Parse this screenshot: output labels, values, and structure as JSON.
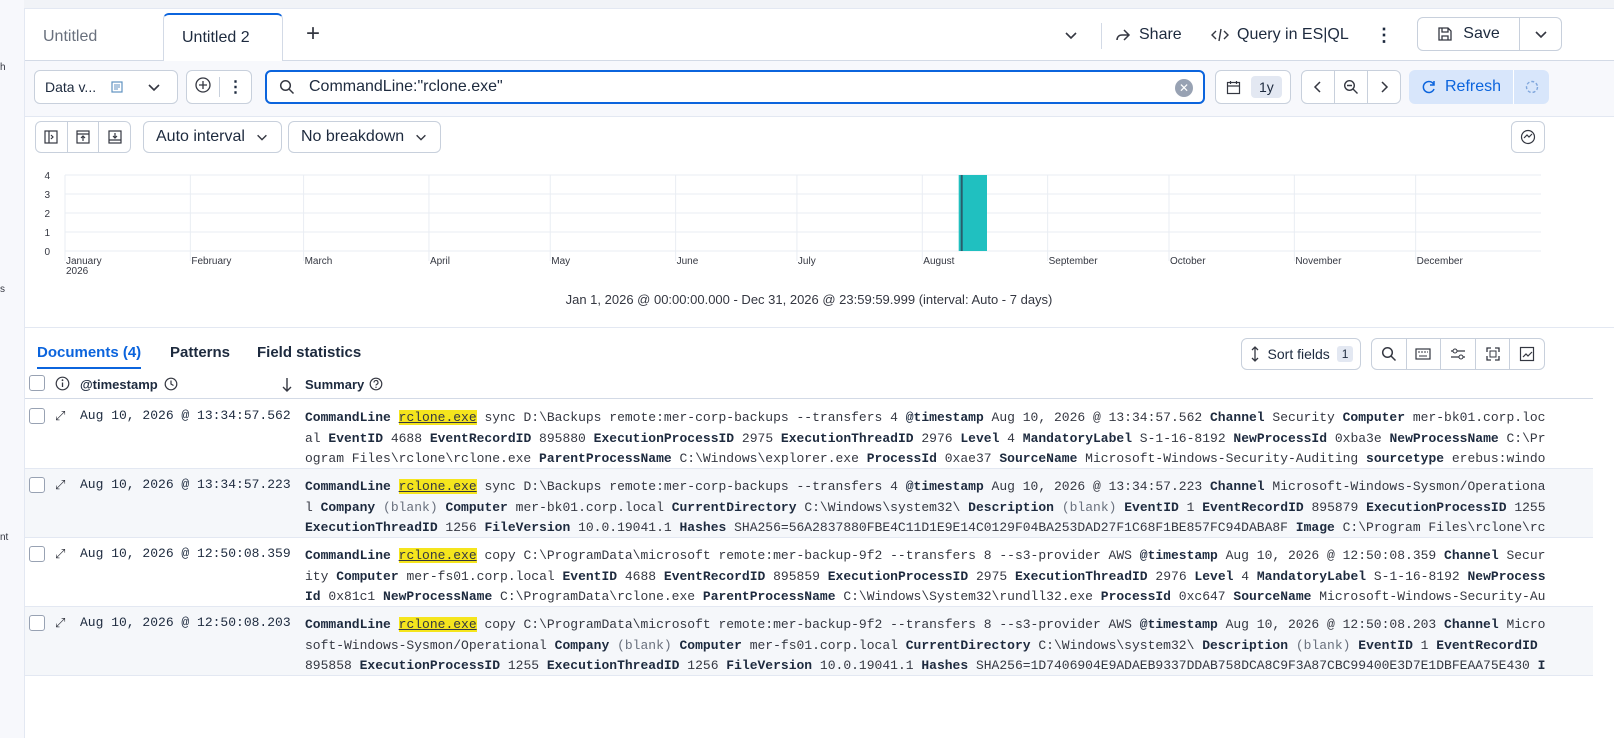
{
  "rail": [
    "h",
    "s",
    "nt"
  ],
  "tabs": [
    {
      "label": "Untitled",
      "active": false
    },
    {
      "label": "Untitled 2",
      "active": true
    }
  ],
  "header": {
    "share_label": "Share",
    "query_label": "Query in ES|QL",
    "save_label": "Save"
  },
  "query": {
    "dataview_label": "Data v...",
    "search_value": "CommandLine:\"rclone.exe\"",
    "time_label": "1y",
    "refresh_label": "Refresh"
  },
  "chart_toolbar": {
    "interval_label": "Auto interval",
    "breakdown_label": "No breakdown"
  },
  "chart_data": {
    "type": "bar",
    "x": [
      "January 2026",
      "February",
      "March",
      "April",
      "May",
      "June",
      "July",
      "August",
      "September",
      "October",
      "November",
      "December"
    ],
    "ylim": [
      0,
      4
    ],
    "yticks": [
      "0",
      "1",
      "2",
      "3",
      "4"
    ],
    "bars": [
      {
        "week_start": "2026-08-10",
        "value": 4
      }
    ],
    "bar_color": "#20c0c0"
  },
  "range_text": "Jan 1, 2026 @ 00:00:00.000 - Dec 31, 2026 @ 23:59:59.999 (interval: Auto - 7 days)",
  "doc_tabs": [
    "Documents (4)",
    "Patterns",
    "Field statistics"
  ],
  "table": {
    "sort_label": "Sort fields",
    "sort_count": "1",
    "col_timestamp": "@timestamp",
    "col_summary": "Summary",
    "rows": [
      {
        "timestamp": "Aug 10, 2026 @ 13:34:57.562",
        "summary": [
          [
            "CommandLine",
            "k"
          ],
          [
            " ",
            "t"
          ],
          [
            "rclone.exe",
            "h"
          ],
          [
            " sync D:\\Backups remote:mer-corp-backups --transfers 4 ",
            "t"
          ],
          [
            "@timestamp",
            "k"
          ],
          [
            " Aug 10, 2026 @ 13:34:57.562 ",
            "t"
          ],
          [
            "Channel",
            "k"
          ],
          [
            " Security ",
            "t"
          ],
          [
            "Computer",
            "k"
          ],
          [
            " mer-bk01.corp.local ",
            "t"
          ],
          [
            "EventID",
            "k"
          ],
          [
            " 4688 ",
            "t"
          ],
          [
            "EventRecordID",
            "k"
          ],
          [
            " 895880 ",
            "t"
          ],
          [
            "ExecutionProcessID",
            "k"
          ],
          [
            " 2975 ",
            "t"
          ],
          [
            "ExecutionThreadID",
            "k"
          ],
          [
            " 2976 ",
            "t"
          ],
          [
            "Level",
            "k"
          ],
          [
            " 4 ",
            "t"
          ],
          [
            "MandatoryLabel",
            "k"
          ],
          [
            " S-1-16-8192 ",
            "t"
          ],
          [
            "NewProcessId",
            "k"
          ],
          [
            " 0xba3e ",
            "t"
          ],
          [
            "NewProcessName",
            "k"
          ],
          [
            " C:\\Program Files\\rclone\\rclone.exe ",
            "t"
          ],
          [
            "ParentProcessName",
            "k"
          ],
          [
            " C:\\Windows\\explorer.exe ",
            "t"
          ],
          [
            "ProcessId",
            "k"
          ],
          [
            " 0xae37 ",
            "t"
          ],
          [
            "SourceName",
            "k"
          ],
          [
            " Microsoft-Windows-Security-Auditing ",
            "t"
          ],
          [
            "sourcetype",
            "k"
          ],
          [
            " erebus:windows_…",
            "t"
          ]
        ]
      },
      {
        "timestamp": "Aug 10, 2026 @ 13:34:57.223",
        "summary": [
          [
            "CommandLine",
            "k"
          ],
          [
            " ",
            "t"
          ],
          [
            "rclone.exe",
            "h"
          ],
          [
            " sync D:\\Backups remote:mer-corp-backups --transfers 4 ",
            "t"
          ],
          [
            "@timestamp",
            "k"
          ],
          [
            " Aug 10, 2026 @ 13:34:57.223 ",
            "t"
          ],
          [
            "Channel",
            "k"
          ],
          [
            " Microsoft-Windows-Sysmon/Operational ",
            "t"
          ],
          [
            "Company",
            "k"
          ],
          [
            " ",
            "t"
          ],
          [
            "(blank)",
            "b"
          ],
          [
            " ",
            "t"
          ],
          [
            "Computer",
            "k"
          ],
          [
            " mer-bk01.corp.local ",
            "t"
          ],
          [
            "CurrentDirectory",
            "k"
          ],
          [
            " C:\\Windows\\system32\\ ",
            "t"
          ],
          [
            "Description",
            "k"
          ],
          [
            " ",
            "t"
          ],
          [
            "(blank)",
            "b"
          ],
          [
            " ",
            "t"
          ],
          [
            "EventID",
            "k"
          ],
          [
            " 1 ",
            "t"
          ],
          [
            "EventRecordID",
            "k"
          ],
          [
            " 895879 ",
            "t"
          ],
          [
            "ExecutionProcessID",
            "k"
          ],
          [
            " 1255 ",
            "t"
          ],
          [
            "ExecutionThreadID",
            "k"
          ],
          [
            " 1256 ",
            "t"
          ],
          [
            "FileVersion",
            "k"
          ],
          [
            " 10.0.19041.1 ",
            "t"
          ],
          [
            "Hashes",
            "k"
          ],
          [
            " SHA256=56A2837880FBE4C11D1E9E14C0129F04BA253DAD27F1C68F1BE857FC94DABA8F ",
            "t"
          ],
          [
            "Image",
            "k"
          ],
          [
            " C:\\Program Files\\rclone\\rcl…",
            "t"
          ]
        ]
      },
      {
        "timestamp": "Aug 10, 2026 @ 12:50:08.359",
        "summary": [
          [
            "CommandLine",
            "k"
          ],
          [
            " ",
            "t"
          ],
          [
            "rclone.exe",
            "h"
          ],
          [
            " copy C:\\ProgramData\\microsoft remote:mer-backup-9f2 --transfers 8 --s3-provider AWS ",
            "t"
          ],
          [
            "@timestamp",
            "k"
          ],
          [
            " Aug 10, 2026 @ 12:50:08.359 ",
            "t"
          ],
          [
            "Channel",
            "k"
          ],
          [
            " Security ",
            "t"
          ],
          [
            "Computer",
            "k"
          ],
          [
            " mer-fs01.corp.local ",
            "t"
          ],
          [
            "EventID",
            "k"
          ],
          [
            " 4688 ",
            "t"
          ],
          [
            "EventRecordID",
            "k"
          ],
          [
            " 895859 ",
            "t"
          ],
          [
            "ExecutionProcessID",
            "k"
          ],
          [
            " 2975 ",
            "t"
          ],
          [
            "ExecutionThreadID",
            "k"
          ],
          [
            " 2976 ",
            "t"
          ],
          [
            "Level",
            "k"
          ],
          [
            " 4 ",
            "t"
          ],
          [
            "MandatoryLabel",
            "k"
          ],
          [
            " S-1-16-8192 ",
            "t"
          ],
          [
            "NewProcessId",
            "k"
          ],
          [
            " 0x81c1 ",
            "t"
          ],
          [
            "NewProcessName",
            "k"
          ],
          [
            " C:\\ProgramData\\rclone.exe ",
            "t"
          ],
          [
            "ParentProcessName",
            "k"
          ],
          [
            " C:\\Windows\\System32\\rundll32.exe ",
            "t"
          ],
          [
            "ProcessId",
            "k"
          ],
          [
            " 0xc647 ",
            "t"
          ],
          [
            "SourceName",
            "k"
          ],
          [
            " Microsoft-Windows-Security-Auditi…",
            "t"
          ]
        ]
      },
      {
        "timestamp": "Aug 10, 2026 @ 12:50:08.203",
        "summary": [
          [
            "CommandLine",
            "k"
          ],
          [
            " ",
            "t"
          ],
          [
            "rclone.exe",
            "h"
          ],
          [
            " copy C:\\ProgramData\\microsoft remote:mer-backup-9f2 --transfers 8 --s3-provider AWS ",
            "t"
          ],
          [
            "@timestamp",
            "k"
          ],
          [
            " Aug 10, 2026 @ 12:50:08.203 ",
            "t"
          ],
          [
            "Channel",
            "k"
          ],
          [
            " Microsoft-Windows-Sysmon/Operational ",
            "t"
          ],
          [
            "Company",
            "k"
          ],
          [
            " ",
            "t"
          ],
          [
            "(blank)",
            "b"
          ],
          [
            " ",
            "t"
          ],
          [
            "Computer",
            "k"
          ],
          [
            " mer-fs01.corp.local ",
            "t"
          ],
          [
            "CurrentDirectory",
            "k"
          ],
          [
            " C:\\Windows\\system32\\ ",
            "t"
          ],
          [
            "Description",
            "k"
          ],
          [
            " ",
            "t"
          ],
          [
            "(blank)",
            "b"
          ],
          [
            " ",
            "t"
          ],
          [
            "EventID",
            "k"
          ],
          [
            " 1 ",
            "t"
          ],
          [
            "EventRecordID",
            "k"
          ],
          [
            " 895858 ",
            "t"
          ],
          [
            "ExecutionProcessID",
            "k"
          ],
          [
            " 1255 ",
            "t"
          ],
          [
            "ExecutionThreadID",
            "k"
          ],
          [
            " 1256 ",
            "t"
          ],
          [
            "FileVersion",
            "k"
          ],
          [
            " 10.0.19041.1 ",
            "t"
          ],
          [
            "Hashes",
            "k"
          ],
          [
            " SHA256=1D7406904E9ADAEB9337DDAB758DCA8C9F3A87CBC99400E3D7E1DBFEAA75E430 ",
            "t"
          ],
          [
            "Image",
            "k"
          ],
          [
            "…",
            "t"
          ]
        ]
      }
    ]
  }
}
